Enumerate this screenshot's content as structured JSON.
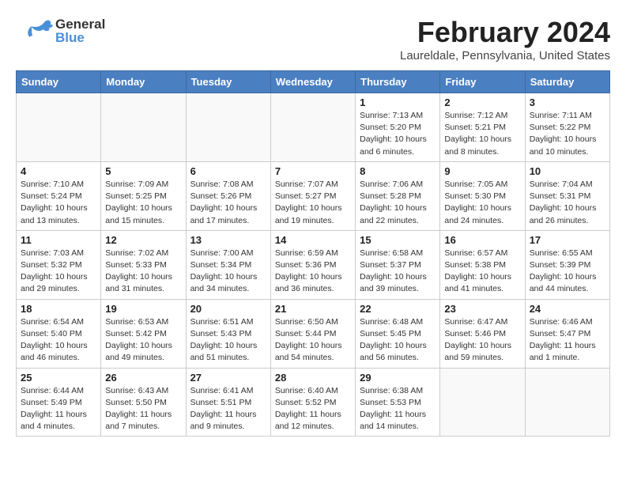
{
  "header": {
    "logo_general": "General",
    "logo_blue": "Blue",
    "month_title": "February 2024",
    "location": "Laureldale, Pennsylvania, United States"
  },
  "weekdays": [
    "Sunday",
    "Monday",
    "Tuesday",
    "Wednesday",
    "Thursday",
    "Friday",
    "Saturday"
  ],
  "weeks": [
    [
      {
        "day": "",
        "info": ""
      },
      {
        "day": "",
        "info": ""
      },
      {
        "day": "",
        "info": ""
      },
      {
        "day": "",
        "info": ""
      },
      {
        "day": "1",
        "info": "Sunrise: 7:13 AM\nSunset: 5:20 PM\nDaylight: 10 hours\nand 6 minutes."
      },
      {
        "day": "2",
        "info": "Sunrise: 7:12 AM\nSunset: 5:21 PM\nDaylight: 10 hours\nand 8 minutes."
      },
      {
        "day": "3",
        "info": "Sunrise: 7:11 AM\nSunset: 5:22 PM\nDaylight: 10 hours\nand 10 minutes."
      }
    ],
    [
      {
        "day": "4",
        "info": "Sunrise: 7:10 AM\nSunset: 5:24 PM\nDaylight: 10 hours\nand 13 minutes."
      },
      {
        "day": "5",
        "info": "Sunrise: 7:09 AM\nSunset: 5:25 PM\nDaylight: 10 hours\nand 15 minutes."
      },
      {
        "day": "6",
        "info": "Sunrise: 7:08 AM\nSunset: 5:26 PM\nDaylight: 10 hours\nand 17 minutes."
      },
      {
        "day": "7",
        "info": "Sunrise: 7:07 AM\nSunset: 5:27 PM\nDaylight: 10 hours\nand 19 minutes."
      },
      {
        "day": "8",
        "info": "Sunrise: 7:06 AM\nSunset: 5:28 PM\nDaylight: 10 hours\nand 22 minutes."
      },
      {
        "day": "9",
        "info": "Sunrise: 7:05 AM\nSunset: 5:30 PM\nDaylight: 10 hours\nand 24 minutes."
      },
      {
        "day": "10",
        "info": "Sunrise: 7:04 AM\nSunset: 5:31 PM\nDaylight: 10 hours\nand 26 minutes."
      }
    ],
    [
      {
        "day": "11",
        "info": "Sunrise: 7:03 AM\nSunset: 5:32 PM\nDaylight: 10 hours\nand 29 minutes."
      },
      {
        "day": "12",
        "info": "Sunrise: 7:02 AM\nSunset: 5:33 PM\nDaylight: 10 hours\nand 31 minutes."
      },
      {
        "day": "13",
        "info": "Sunrise: 7:00 AM\nSunset: 5:34 PM\nDaylight: 10 hours\nand 34 minutes."
      },
      {
        "day": "14",
        "info": "Sunrise: 6:59 AM\nSunset: 5:36 PM\nDaylight: 10 hours\nand 36 minutes."
      },
      {
        "day": "15",
        "info": "Sunrise: 6:58 AM\nSunset: 5:37 PM\nDaylight: 10 hours\nand 39 minutes."
      },
      {
        "day": "16",
        "info": "Sunrise: 6:57 AM\nSunset: 5:38 PM\nDaylight: 10 hours\nand 41 minutes."
      },
      {
        "day": "17",
        "info": "Sunrise: 6:55 AM\nSunset: 5:39 PM\nDaylight: 10 hours\nand 44 minutes."
      }
    ],
    [
      {
        "day": "18",
        "info": "Sunrise: 6:54 AM\nSunset: 5:40 PM\nDaylight: 10 hours\nand 46 minutes."
      },
      {
        "day": "19",
        "info": "Sunrise: 6:53 AM\nSunset: 5:42 PM\nDaylight: 10 hours\nand 49 minutes."
      },
      {
        "day": "20",
        "info": "Sunrise: 6:51 AM\nSunset: 5:43 PM\nDaylight: 10 hours\nand 51 minutes."
      },
      {
        "day": "21",
        "info": "Sunrise: 6:50 AM\nSunset: 5:44 PM\nDaylight: 10 hours\nand 54 minutes."
      },
      {
        "day": "22",
        "info": "Sunrise: 6:48 AM\nSunset: 5:45 PM\nDaylight: 10 hours\nand 56 minutes."
      },
      {
        "day": "23",
        "info": "Sunrise: 6:47 AM\nSunset: 5:46 PM\nDaylight: 10 hours\nand 59 minutes."
      },
      {
        "day": "24",
        "info": "Sunrise: 6:46 AM\nSunset: 5:47 PM\nDaylight: 11 hours\nand 1 minute."
      }
    ],
    [
      {
        "day": "25",
        "info": "Sunrise: 6:44 AM\nSunset: 5:49 PM\nDaylight: 11 hours\nand 4 minutes."
      },
      {
        "day": "26",
        "info": "Sunrise: 6:43 AM\nSunset: 5:50 PM\nDaylight: 11 hours\nand 7 minutes."
      },
      {
        "day": "27",
        "info": "Sunrise: 6:41 AM\nSunset: 5:51 PM\nDaylight: 11 hours\nand 9 minutes."
      },
      {
        "day": "28",
        "info": "Sunrise: 6:40 AM\nSunset: 5:52 PM\nDaylight: 11 hours\nand 12 minutes."
      },
      {
        "day": "29",
        "info": "Sunrise: 6:38 AM\nSunset: 5:53 PM\nDaylight: 11 hours\nand 14 minutes."
      },
      {
        "day": "",
        "info": ""
      },
      {
        "day": "",
        "info": ""
      }
    ]
  ]
}
